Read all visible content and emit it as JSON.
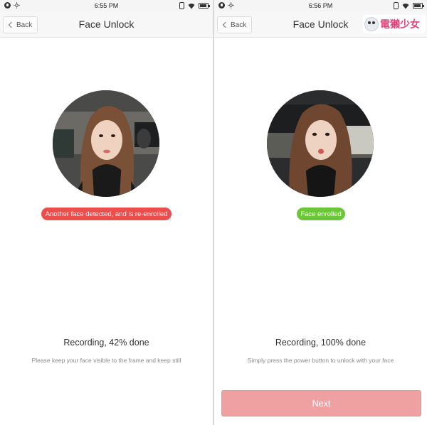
{
  "left_screen": {
    "status": {
      "time": "6:55 PM"
    },
    "nav": {
      "back_label": "Back",
      "title": "Face Unlock"
    },
    "badge": {
      "text": "Another face detected, and is re-enrolled",
      "color": "#ec4d4d"
    },
    "progress": {
      "title": "Recording, 42% done",
      "percent": 42
    },
    "hint": "Please keep your face visible to the frame and keep still"
  },
  "right_screen": {
    "status": {
      "time": "6:56 PM"
    },
    "nav": {
      "back_label": "Back",
      "title": "Face Unlock"
    },
    "watermark": {
      "text": "電獺少女"
    },
    "badge": {
      "text": "Face enrolled",
      "color": "#6bc737"
    },
    "progress": {
      "title": "Recording, 100% done",
      "percent": 100
    },
    "hint": "Simply press the power button to unlock with your face",
    "next_button": {
      "label": "Next"
    }
  },
  "icons": {
    "status_left": [
      "notification-dot-icon",
      "brightness-icon"
    ],
    "status_right": [
      "vibrate-icon",
      "wifi-icon",
      "battery-icon"
    ],
    "nav": [
      "chevron-left-icon"
    ]
  },
  "colors": {
    "accent_red": "#ec4d4d",
    "accent_green": "#6bc737",
    "next_button": "#efa1a1"
  }
}
